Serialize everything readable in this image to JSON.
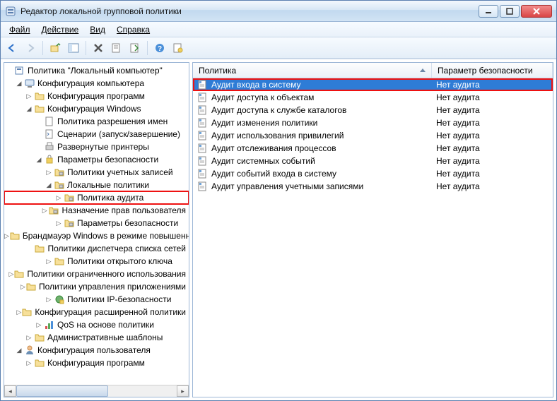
{
  "window": {
    "title": "Редактор локальной групповой политики"
  },
  "menu": {
    "file": "Файл",
    "action": "Действие",
    "view": "Вид",
    "help": "Справка"
  },
  "tree": {
    "root": "Политика \"Локальный компьютер\"",
    "cc": "Конфигурация компьютера",
    "cc_prog": "Конфигурация программ",
    "cc_win": "Конфигурация Windows",
    "cc_win_nameres": "Политика разрешения имен",
    "cc_win_scripts": "Сценарии (запуск/завершение)",
    "cc_win_printers": "Развернутые принтеры",
    "cc_win_sec": "Параметры безопасности",
    "sec_acct": "Политики учетных записей",
    "sec_local": "Локальные политики",
    "sec_local_audit": "Политика аудита",
    "sec_local_rights": "Назначение прав пользователя",
    "sec_local_opts": "Параметры безопасности",
    "sec_firewall": "Брандмауэр Windows в режиме повышенной",
    "sec_netlist": "Политики диспетчера списка сетей",
    "sec_pubkey": "Политики открытого ключа",
    "sec_restrict": "Политики ограниченного использования",
    "sec_appctrl": "Политики управления приложениями",
    "sec_ipsec": "Политики IP-безопасности",
    "sec_advaudit": "Конфигурация расширенной политики",
    "cc_win_qos": "QoS на основе политики",
    "cc_admin": "Административные шаблоны",
    "cu": "Конфигурация пользователя",
    "cu_prog": "Конфигурация программ"
  },
  "columns": {
    "policy": "Политика",
    "param": "Параметр безопасности"
  },
  "col_widths": {
    "policy": 338,
    "param": 160
  },
  "rows": [
    {
      "name": "Аудит входа в систему",
      "value": "Нет аудита",
      "selected": true
    },
    {
      "name": "Аудит доступа к объектам",
      "value": "Нет аудита"
    },
    {
      "name": "Аудит доступа к службе каталогов",
      "value": "Нет аудита"
    },
    {
      "name": "Аудит изменения политики",
      "value": "Нет аудита"
    },
    {
      "name": "Аудит использования привилегий",
      "value": "Нет аудита"
    },
    {
      "name": "Аудит отслеживания процессов",
      "value": "Нет аудита"
    },
    {
      "name": "Аудит системных событий",
      "value": "Нет аудита"
    },
    {
      "name": "Аудит событий входа в систему",
      "value": "Нет аудита"
    },
    {
      "name": "Аудит управления учетными записями",
      "value": "Нет аудита"
    }
  ]
}
